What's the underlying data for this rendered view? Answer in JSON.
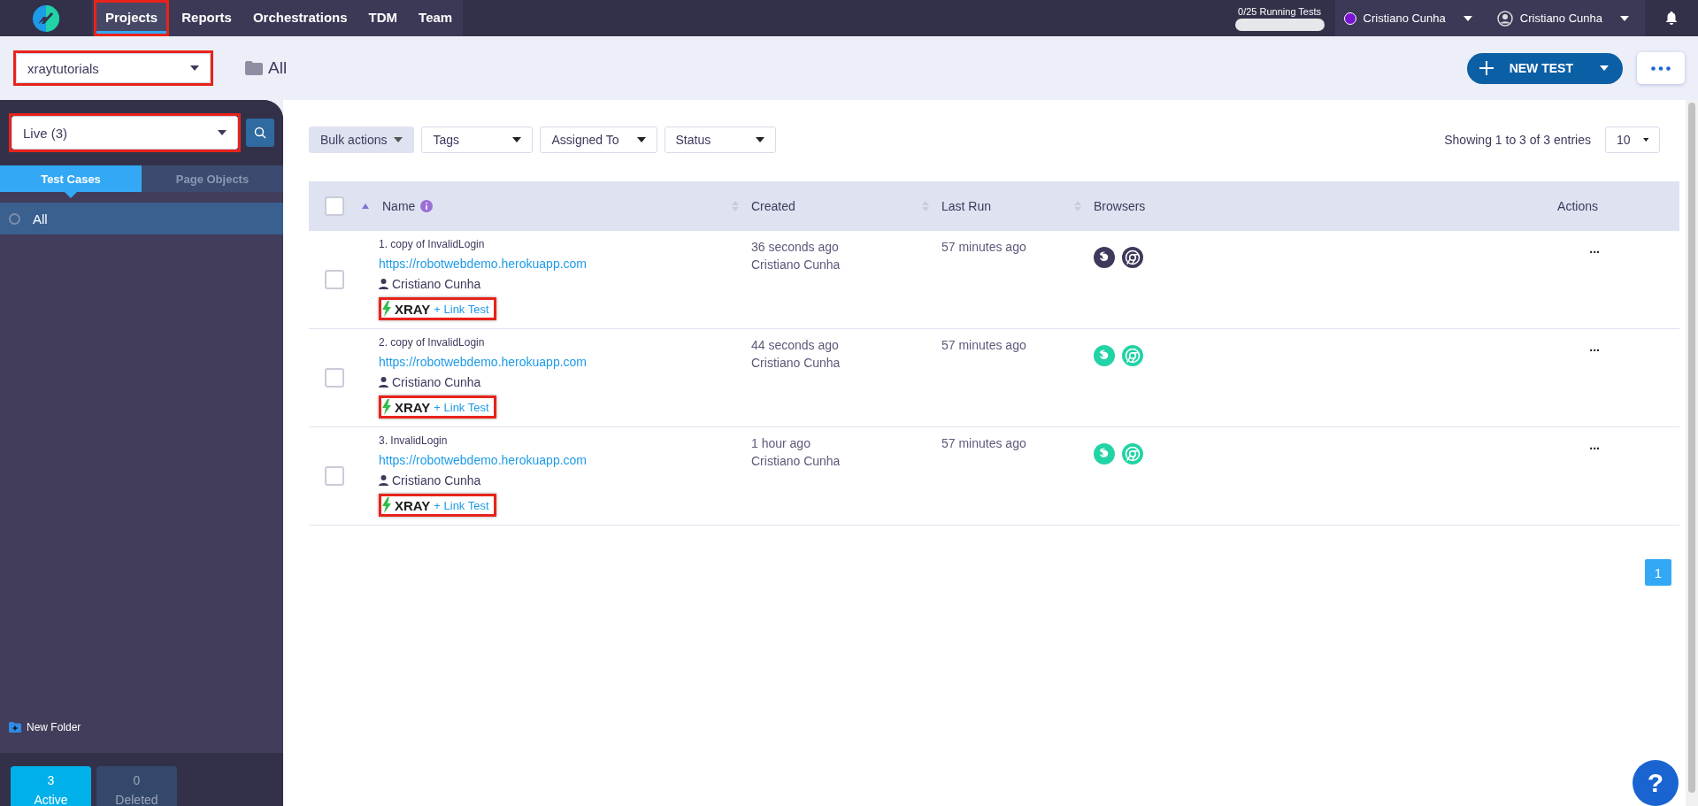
{
  "nav": {
    "items": [
      {
        "label": "Projects",
        "selected": true,
        "highlighted": true
      },
      {
        "label": "Reports",
        "selected": false,
        "highlighted": false
      },
      {
        "label": "Orchestrations",
        "selected": false,
        "highlighted": false
      },
      {
        "label": "TDM",
        "selected": false,
        "highlighted": false
      },
      {
        "label": "Team",
        "selected": false,
        "highlighted": false
      }
    ]
  },
  "running_tests": {
    "label": "0/25 Running Tests",
    "level": 0
  },
  "user_menus": [
    {
      "kind": "organization",
      "label": "Cristiano Cunha",
      "color": "#7a12d4"
    },
    {
      "kind": "user",
      "label": "Cristiano Cunha"
    }
  ],
  "toolbar": {
    "project": {
      "value": "xraytutorials",
      "highlighted": true
    },
    "folder": "All",
    "new_test": "NEW TEST"
  },
  "sidebar": {
    "filter": {
      "value": "Live (3)",
      "highlighted": true
    },
    "tabs": [
      {
        "label": "Test Cases",
        "selected": true
      },
      {
        "label": "Page Objects",
        "selected": false
      }
    ],
    "folders": [
      {
        "label": "All",
        "selected": true
      }
    ],
    "new_folder": "New Folder",
    "counters": [
      {
        "count": "3",
        "label": "Active",
        "selected": true
      },
      {
        "count": "0",
        "label": "Deleted",
        "selected": false
      }
    ]
  },
  "filters": [
    {
      "label": "Bulk actions",
      "kind": "action"
    },
    {
      "label": "Tags",
      "kind": "select"
    },
    {
      "label": "Assigned To",
      "kind": "select"
    },
    {
      "label": "Status",
      "kind": "select"
    }
  ],
  "entries_info": "Showing 1 to 3 of 3 entries",
  "page_size": "10",
  "table": {
    "select_all": {
      "checked": false
    },
    "columns": [
      {
        "label": "Name",
        "sortable": true,
        "sorted": true,
        "info": true
      },
      {
        "label": "Created",
        "sortable": true,
        "sorted": false,
        "info": false
      },
      {
        "label": "Last Run",
        "sortable": true,
        "sorted": false,
        "info": false
      },
      {
        "label": "Browsers",
        "sortable": false,
        "sorted": false,
        "info": false
      },
      {
        "label": "Actions",
        "sortable": false,
        "sorted": false,
        "info": false
      }
    ],
    "rows": [
      {
        "name": "1. copy of InvalidLogin",
        "url": "https://robotwebdemo.herokuapp.com",
        "owner": "Cristiano Cunha",
        "xray": "XRAY",
        "link": "+ Link Test",
        "highlighted": true,
        "checked": false,
        "created": "36 seconds ago",
        "created_by": "Cristiano Cunha",
        "last_run": "57 minutes ago",
        "browsers": [
          {
            "kind": "firefox",
            "color": "#3d3a5c"
          },
          {
            "kind": "chrome",
            "color": "#3d3a5c"
          }
        ],
        "actions": "..."
      },
      {
        "name": "2. copy of InvalidLogin",
        "url": "https://robotwebdemo.herokuapp.com",
        "owner": "Cristiano Cunha",
        "xray": "XRAY",
        "link": "+ Link Test",
        "highlighted": true,
        "checked": false,
        "created": "44 seconds ago",
        "created_by": "Cristiano Cunha",
        "last_run": "57 minutes ago",
        "browsers": [
          {
            "kind": "firefox",
            "color": "#22d3a5"
          },
          {
            "kind": "chrome",
            "color": "#22d3a5"
          }
        ],
        "actions": "..."
      },
      {
        "name": "3. InvalidLogin",
        "url": "https://robotwebdemo.herokuapp.com",
        "owner": "Cristiano Cunha",
        "xray": "XRAY",
        "link": "+ Link Test",
        "highlighted": true,
        "checked": false,
        "created": "1 hour ago",
        "created_by": "Cristiano Cunha",
        "last_run": "57 minutes ago",
        "browsers": [
          {
            "kind": "firefox",
            "color": "#22d3a5"
          },
          {
            "kind": "chrome",
            "color": "#22d3a5"
          }
        ],
        "actions": "..."
      }
    ]
  },
  "pagination": [
    {
      "label": "1",
      "selected": true
    }
  ],
  "help": "?"
}
